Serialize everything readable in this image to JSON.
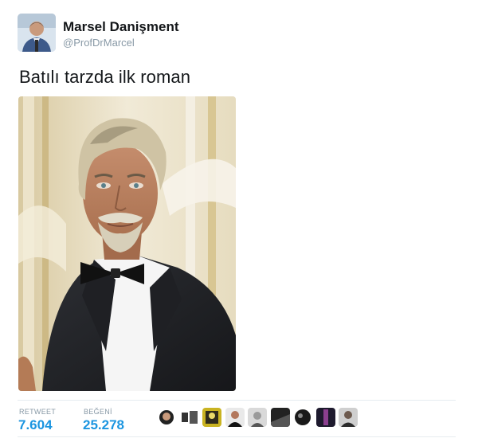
{
  "tweet": {
    "display_name": "Marsel Danişment",
    "handle": "@ProfDrMarcel",
    "text": "Batılı tarzda ilk roman"
  },
  "stats": {
    "retweet_label": "RETWEET",
    "retweet_count": "7.604",
    "like_label": "BEĞENİ",
    "like_count": "25.278"
  },
  "likers": [
    {
      "name": "liker-avatar-1"
    },
    {
      "name": "liker-avatar-2"
    },
    {
      "name": "liker-avatar-3"
    },
    {
      "name": "liker-avatar-4"
    },
    {
      "name": "liker-avatar-5"
    },
    {
      "name": "liker-avatar-6"
    },
    {
      "name": "liker-avatar-7"
    },
    {
      "name": "liker-avatar-8"
    },
    {
      "name": "liker-avatar-9"
    }
  ],
  "colors": {
    "accent": "#1b95e0",
    "secondary_text": "#8899a6",
    "divider": "#e6ecf0"
  }
}
